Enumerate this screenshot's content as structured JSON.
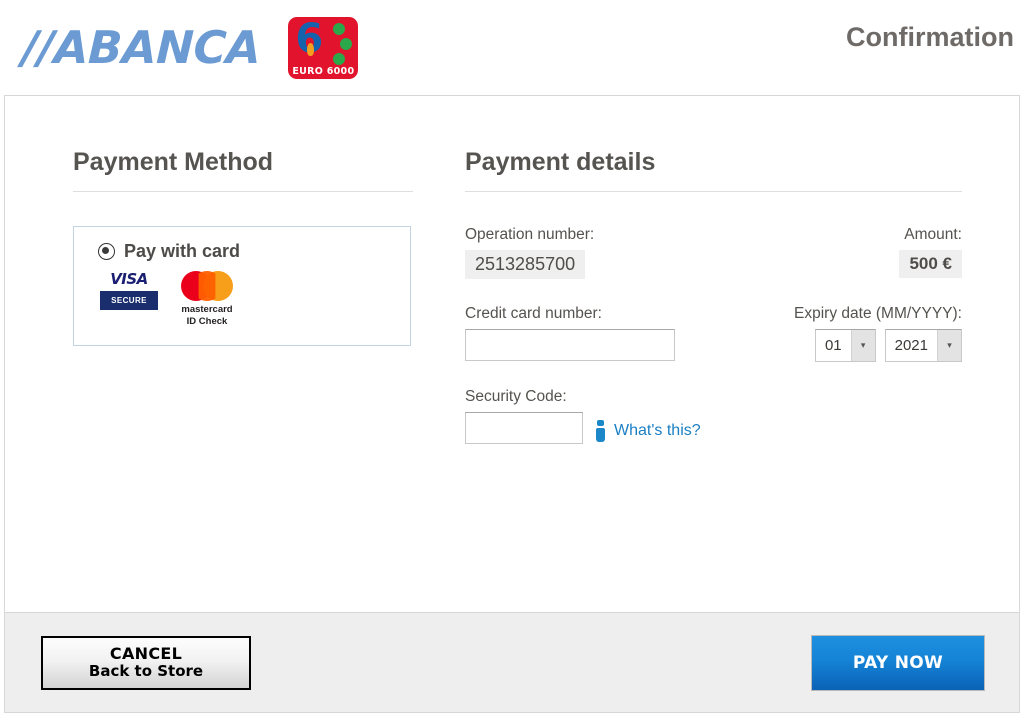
{
  "header": {
    "brand": "//ABANCA",
    "network_logo": {
      "digit": "6",
      "label": "EURO 6000"
    },
    "page_title": "Confirmation"
  },
  "payment_method": {
    "section_title": "Payment Method",
    "option_label": "Pay with card",
    "option_selected": true,
    "logos": {
      "visa": "VISA",
      "visa_secure": "SECURE",
      "mastercard_line1": "mastercard",
      "mastercard_line2": "ID Check"
    }
  },
  "payment_details": {
    "section_title": "Payment details",
    "operation_number_label": "Operation number:",
    "operation_number_value": "2513285700",
    "amount_label": "Amount:",
    "amount_value": "500 €",
    "card_number_label": "Credit card number:",
    "card_number_value": "",
    "expiry_label": "Expiry date (MM/YYYY):",
    "expiry_month": "01",
    "expiry_year": "2021",
    "security_code_label": "Security Code:",
    "security_code_value": "",
    "whats_this": "What's this?"
  },
  "footer": {
    "cancel_line1": "CANCEL",
    "cancel_line2": "Back to Store",
    "pay_now": "PAY NOW"
  },
  "colors": {
    "brand_blue": "#6b9bd2",
    "accent_red": "#e2142d",
    "link_blue": "#1b7fc4",
    "pay_button_blue": "#1583d6"
  }
}
